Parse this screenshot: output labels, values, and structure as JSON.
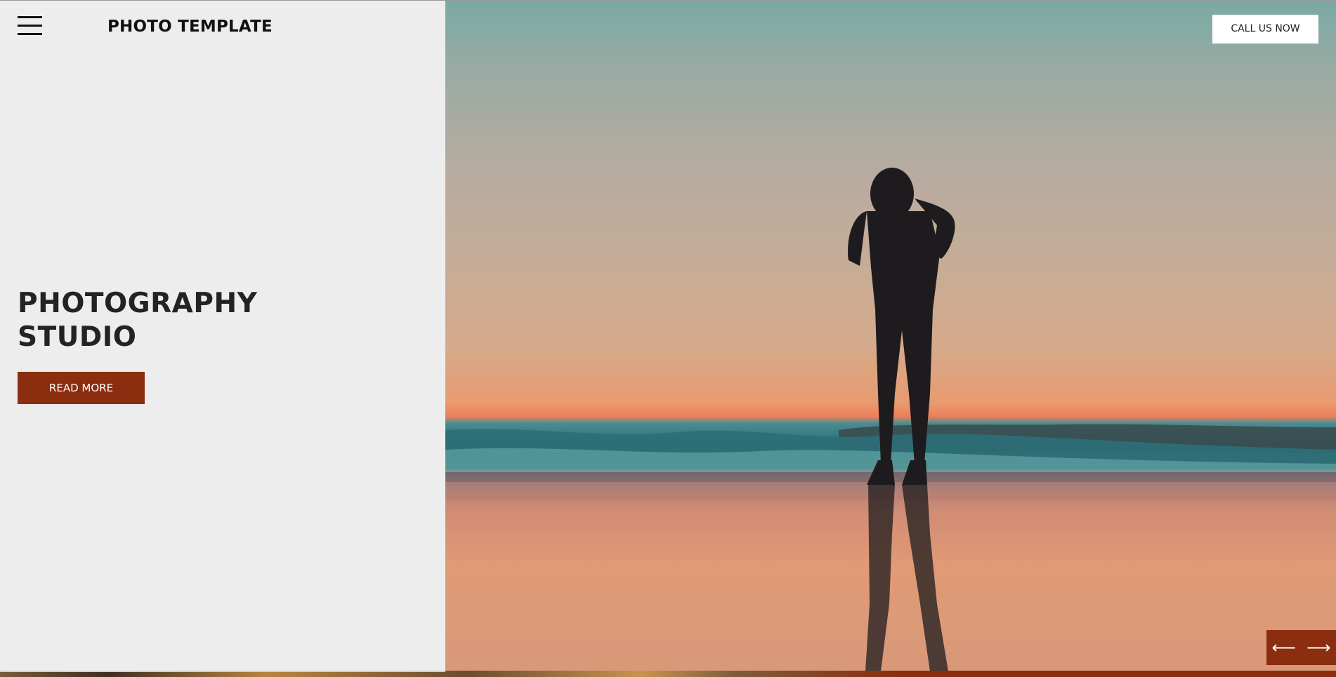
{
  "header": {
    "brand": "PHOTO TEMPLATE",
    "menu_icon": "hamburger-menu-icon",
    "call_label": "CALL US NOW"
  },
  "hero": {
    "title_line1": "PHOTOGRAPHY",
    "title_line2": "STUDIO",
    "cta_label": "READ MORE",
    "image_subject": "Silhouette of a person photographing a beach sunset"
  },
  "slider": {
    "prev_icon": "arrow-left-icon",
    "next_icon": "arrow-right-icon",
    "prev_glyph": "⟵",
    "next_glyph": "⟶"
  },
  "colors": {
    "accent": "#8a2e0f",
    "panel_bg": "#ededed",
    "text_dark": "#232323"
  }
}
